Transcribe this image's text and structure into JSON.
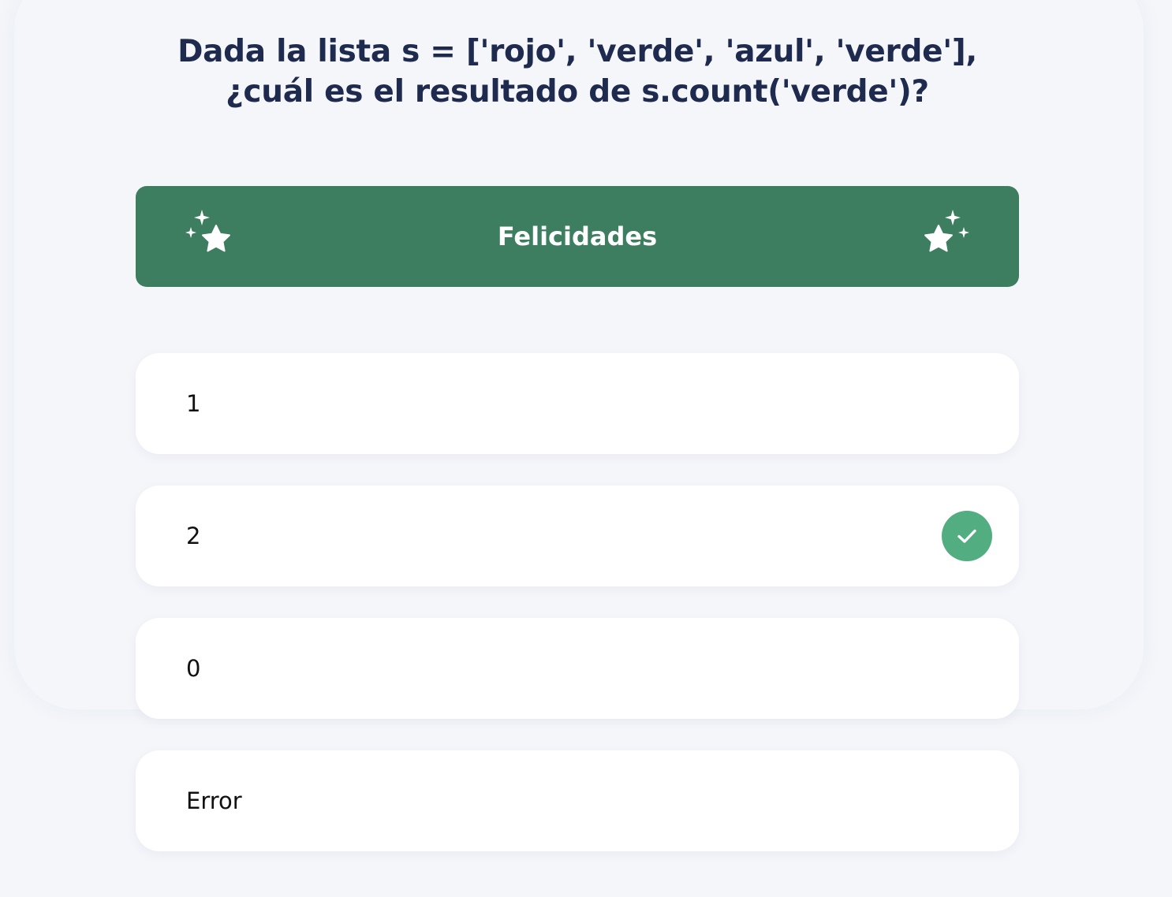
{
  "question": {
    "text": "Dada la lista s = ['rojo', 'verde', 'azul', 'verde'], ¿cuál es el resultado de s.count('verde')?"
  },
  "banner": {
    "title": "Felicidades",
    "left_icon": "sparkle-star-icon",
    "right_icon": "sparkle-star-icon",
    "color": "#3d7e61"
  },
  "options": [
    {
      "label": "1",
      "state": "default"
    },
    {
      "label": "2",
      "state": "correct",
      "icon": "check-icon"
    },
    {
      "label": "0",
      "state": "default"
    },
    {
      "label": "Error",
      "state": "default"
    }
  ],
  "colors": {
    "background": "#f4f6fa",
    "heading": "#1f2a4f",
    "correct": "#52ad80",
    "option_bg": "#ffffff"
  }
}
